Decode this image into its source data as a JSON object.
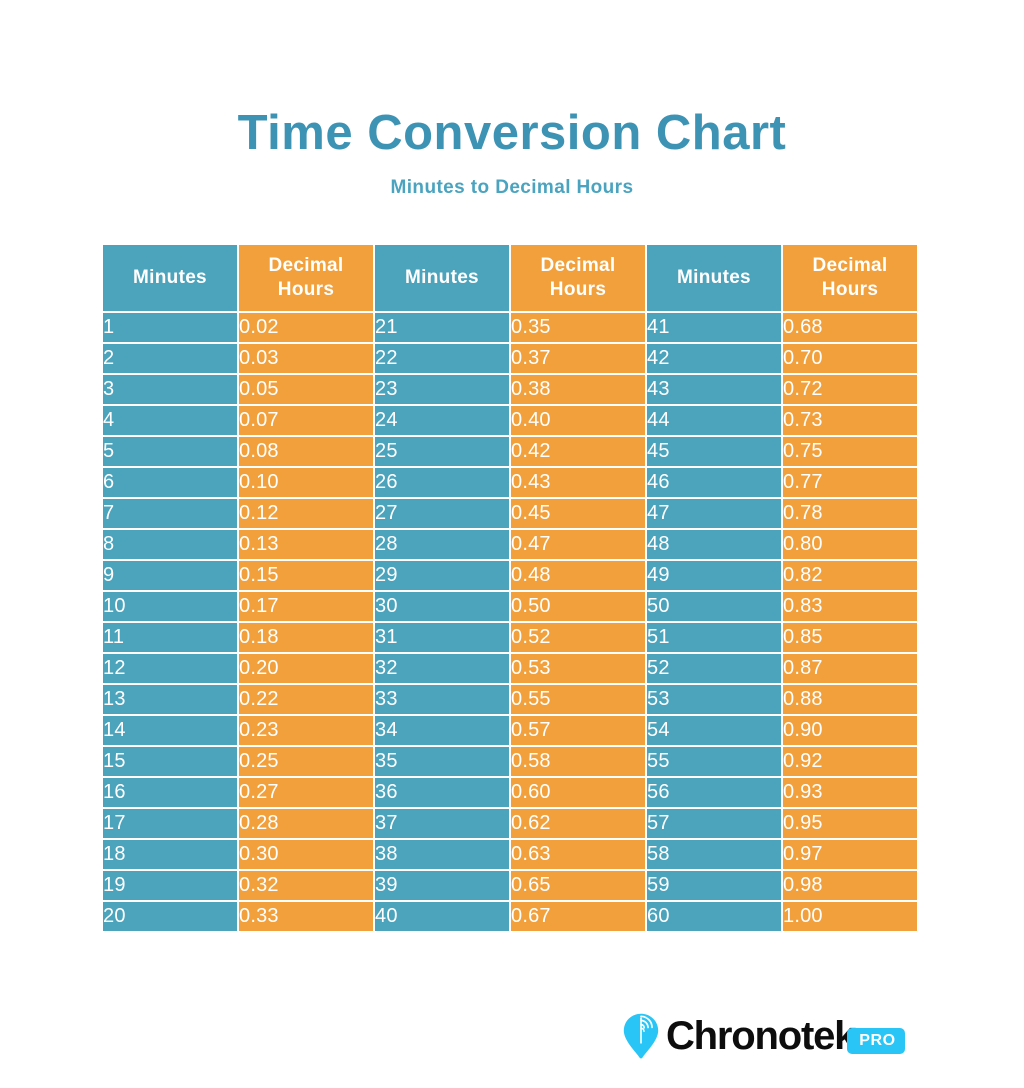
{
  "header": {
    "title": "Time Conversion Chart",
    "subtitle": "Minutes to Decimal Hours"
  },
  "colors": {
    "teal": "#4ba3bc",
    "orange": "#f2a03c",
    "title_teal": "#3d93b4",
    "logo_cyan": "#29c5f6",
    "background": "#ffffff",
    "cell_text": "#ffffff"
  },
  "table": {
    "headers": [
      "Minutes",
      "Decimal Hours",
      "Minutes",
      "Decimal Hours",
      "Minutes",
      "Decimal Hours"
    ],
    "header_group_labels": {
      "minutes": "Minutes",
      "decimal_hours": "Decimal Hours"
    },
    "rows": [
      [
        "1",
        "0.02",
        "21",
        "0.35",
        "41",
        "0.68"
      ],
      [
        "2",
        "0.03",
        "22",
        "0.37",
        "42",
        "0.70"
      ],
      [
        "3",
        "0.05",
        "23",
        "0.38",
        "43",
        "0.72"
      ],
      [
        "4",
        "0.07",
        "24",
        "0.40",
        "44",
        "0.73"
      ],
      [
        "5",
        "0.08",
        "25",
        "0.42",
        "45",
        "0.75"
      ],
      [
        "6",
        "0.10",
        "26",
        "0.43",
        "46",
        "0.77"
      ],
      [
        "7",
        "0.12",
        "27",
        "0.45",
        "47",
        "0.78"
      ],
      [
        "8",
        "0.13",
        "28",
        "0.47",
        "48",
        "0.80"
      ],
      [
        "9",
        "0.15",
        "29",
        "0.48",
        "49",
        "0.82"
      ],
      [
        "10",
        "0.17",
        "30",
        "0.50",
        "50",
        "0.83"
      ],
      [
        "11",
        "0.18",
        "31",
        "0.52",
        "51",
        "0.85"
      ],
      [
        "12",
        "0.20",
        "32",
        "0.53",
        "52",
        "0.87"
      ],
      [
        "13",
        "0.22",
        "33",
        "0.55",
        "53",
        "0.88"
      ],
      [
        "14",
        "0.23",
        "34",
        "0.57",
        "54",
        "0.90"
      ],
      [
        "15",
        "0.25",
        "35",
        "0.58",
        "55",
        "0.92"
      ],
      [
        "16",
        "0.27",
        "36",
        "0.60",
        "56",
        "0.93"
      ],
      [
        "17",
        "0.28",
        "37",
        "0.62",
        "57",
        "0.95"
      ],
      [
        "18",
        "0.30",
        "38",
        "0.63",
        "58",
        "0.97"
      ],
      [
        "19",
        "0.32",
        "39",
        "0.65",
        "59",
        "0.98"
      ],
      [
        "20",
        "0.33",
        "40",
        "0.67",
        "60",
        "1.00"
      ]
    ]
  },
  "logo": {
    "wordmark": "Chronotek",
    "badge": "PRO",
    "pin_icon": "location-pin-signal-icon"
  },
  "chart_data": {
    "type": "table",
    "title": "Time Conversion Chart",
    "subtitle": "Minutes to Decimal Hours",
    "columns": [
      "Minutes",
      "Decimal Hours"
    ],
    "categories": [
      "1",
      "2",
      "3",
      "4",
      "5",
      "6",
      "7",
      "8",
      "9",
      "10",
      "11",
      "12",
      "13",
      "14",
      "15",
      "16",
      "17",
      "18",
      "19",
      "20",
      "21",
      "22",
      "23",
      "24",
      "25",
      "26",
      "27",
      "28",
      "29",
      "30",
      "31",
      "32",
      "33",
      "34",
      "35",
      "36",
      "37",
      "38",
      "39",
      "40",
      "41",
      "42",
      "43",
      "44",
      "45",
      "46",
      "47",
      "48",
      "49",
      "50",
      "51",
      "52",
      "53",
      "54",
      "55",
      "56",
      "57",
      "58",
      "59",
      "60"
    ],
    "values": [
      0.02,
      0.03,
      0.05,
      0.07,
      0.08,
      0.1,
      0.12,
      0.13,
      0.15,
      0.17,
      0.18,
      0.2,
      0.22,
      0.23,
      0.25,
      0.27,
      0.28,
      0.3,
      0.32,
      0.33,
      0.35,
      0.37,
      0.38,
      0.4,
      0.42,
      0.43,
      0.45,
      0.47,
      0.48,
      0.5,
      0.52,
      0.53,
      0.55,
      0.57,
      0.58,
      0.6,
      0.62,
      0.63,
      0.65,
      0.67,
      0.68,
      0.7,
      0.72,
      0.73,
      0.75,
      0.77,
      0.78,
      0.8,
      0.82,
      0.83,
      0.85,
      0.87,
      0.88,
      0.9,
      0.92,
      0.93,
      0.95,
      0.97,
      0.98,
      1.0
    ],
    "xlabel": "Minutes",
    "ylabel": "Decimal Hours",
    "ylim": [
      0.02,
      1.0
    ],
    "grid": false,
    "legend": "none"
  }
}
